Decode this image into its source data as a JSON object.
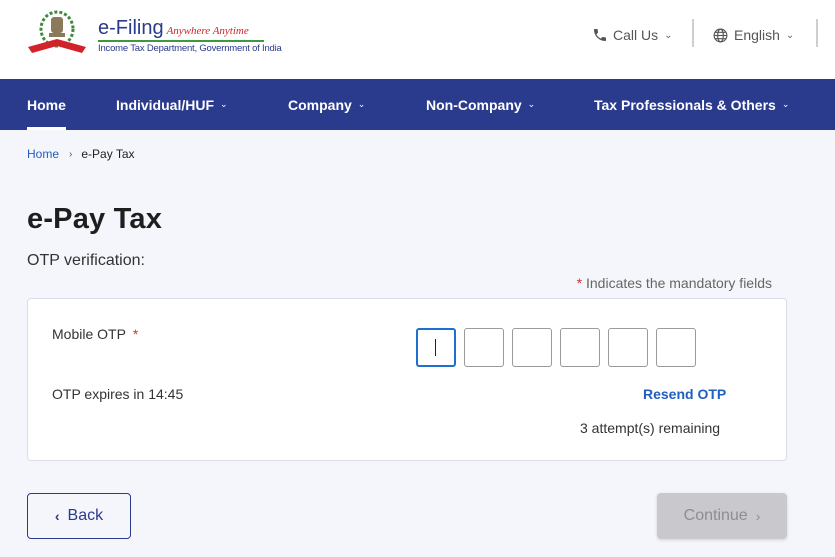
{
  "header": {
    "logo_title": "e-Filing",
    "logo_tagline": "Anywhere Anytime",
    "logo_subtitle": "Income Tax Department, Government of India",
    "call_us_label": "Call Us",
    "language_label": "English",
    "icons": {
      "call": "phone-icon",
      "language": "globe-icon",
      "dropdown": "chevron-down-icon"
    }
  },
  "nav": {
    "items": [
      {
        "label": "Home",
        "active": true,
        "has_dropdown": false
      },
      {
        "label": "Individual/HUF",
        "active": false,
        "has_dropdown": true
      },
      {
        "label": "Company",
        "active": false,
        "has_dropdown": true
      },
      {
        "label": "Non-Company",
        "active": false,
        "has_dropdown": true
      },
      {
        "label": "Tax Professionals & Others",
        "active": false,
        "has_dropdown": true
      }
    ],
    "caret": "⌄"
  },
  "breadcrumb": {
    "home": "Home",
    "separator": "›",
    "current": "e-Pay Tax"
  },
  "page": {
    "title": "e-Pay Tax",
    "subtitle": "OTP verification:",
    "mandatory_star": "*",
    "mandatory_note": " Indicates the mandatory fields"
  },
  "otp_form": {
    "label": "Mobile OTP",
    "required_mark": "*",
    "digits": [
      "",
      "",
      "",
      "",
      "",
      ""
    ],
    "expiry_text": "OTP expires in 14:45",
    "resend_label": "Resend OTP",
    "attempts_text": "3 attempt(s) remaining"
  },
  "actions": {
    "back_label": "Back",
    "back_icon": "‹",
    "continue_label": "Continue",
    "continue_icon": "›",
    "continue_disabled": true
  },
  "colors": {
    "brand": "#2a3a8c",
    "link": "#1f5fbf",
    "required": "#d0312d",
    "focus": "#1f6fd0",
    "disabled_bg": "#c9c8cd",
    "page_bg": "#f5f6fb"
  }
}
